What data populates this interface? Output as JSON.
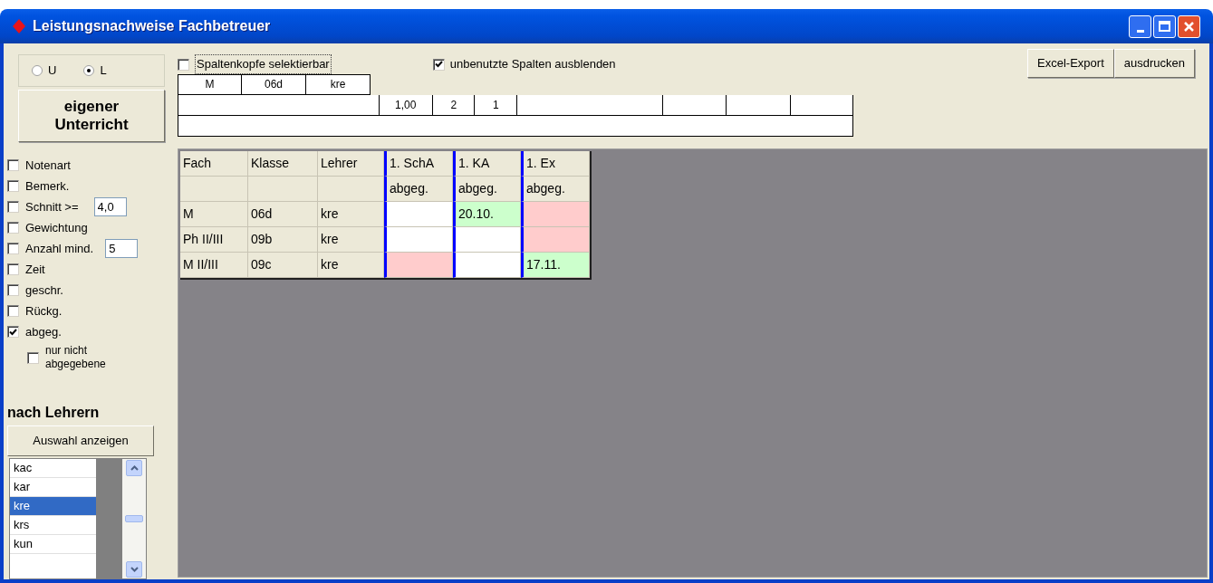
{
  "window": {
    "title": "Leistungsnachweise Fachbetreuer"
  },
  "mode_radios": [
    {
      "label": "U",
      "selected": false
    },
    {
      "label": "L",
      "selected": true
    }
  ],
  "own_lessons_button": "eigener Unterricht",
  "options": [
    {
      "label": "Notenart",
      "checked": false
    },
    {
      "label": "Bemerk.",
      "checked": false
    },
    {
      "label": "Schnitt >=",
      "checked": false,
      "value": "4,0"
    },
    {
      "label": "Gewichtung",
      "checked": false
    },
    {
      "label": "Anzahl mind.",
      "checked": false,
      "value": "5"
    },
    {
      "label": "Zeit",
      "checked": false
    },
    {
      "label": "geschr.",
      "checked": false
    },
    {
      "label": "Rückg.",
      "checked": false
    },
    {
      "label": "abgeg.",
      "checked": true,
      "children": [
        {
          "label": "nur nicht abgegebene",
          "checked": false
        }
      ]
    }
  ],
  "teacher_filter": {
    "title": "nach Lehrern",
    "button": "Auswahl anzeigen",
    "items": [
      {
        "label": "kac",
        "selected": false
      },
      {
        "label": "kar",
        "selected": false
      },
      {
        "label": "kre",
        "selected": true
      },
      {
        "label": "krs",
        "selected": false
      },
      {
        "label": "kun",
        "selected": false
      }
    ]
  },
  "column_header_checkbox": {
    "label": "Spaltenkopfe selektierbar",
    "checked": false
  },
  "hide_unused_checkbox": {
    "label": "unbenutzte Spalten ausblenden",
    "checked": true
  },
  "buttons": [
    "Excel-Export",
    "ausdrucken"
  ],
  "header_grid": {
    "row_1": [
      "M",
      "06d",
      "kre"
    ],
    "row_2_values": [
      "1,00",
      "2",
      "1"
    ]
  },
  "table": {
    "columns": [
      {
        "label": "Fach",
        "kind": "info"
      },
      {
        "label": "Klasse",
        "kind": "info"
      },
      {
        "label": "Lehrer",
        "kind": "info"
      },
      {
        "label": "1. SchA",
        "sublabel": "abgeg.",
        "kind": "exam"
      },
      {
        "label": "1. KA",
        "sublabel": "abgeg.",
        "kind": "exam"
      },
      {
        "label": "1. Ex",
        "sublabel": "abgeg.",
        "kind": "exam"
      }
    ],
    "rows": [
      {
        "cells": [
          {
            "text": "M"
          },
          {
            "text": "06d"
          },
          {
            "text": "kre"
          },
          {
            "color": "#ffffff"
          },
          {
            "text": "20.10.",
            "color": "#ccffcc"
          },
          {
            "color": "#ffcccc"
          }
        ]
      },
      {
        "cells": [
          {
            "text": "Ph II/III"
          },
          {
            "text": "09b"
          },
          {
            "text": "kre"
          },
          {
            "color": "#ffffff"
          },
          {
            "color": "#ffffff"
          },
          {
            "color": "#ffcccc"
          }
        ]
      },
      {
        "cells": [
          {
            "text": "M II/III"
          },
          {
            "text": "09c"
          },
          {
            "text": "kre"
          },
          {
            "color": "#ffcccc"
          },
          {
            "color": "#ffffff"
          },
          {
            "text": "17.11.",
            "color": "#ccffcc"
          }
        ]
      }
    ]
  }
}
